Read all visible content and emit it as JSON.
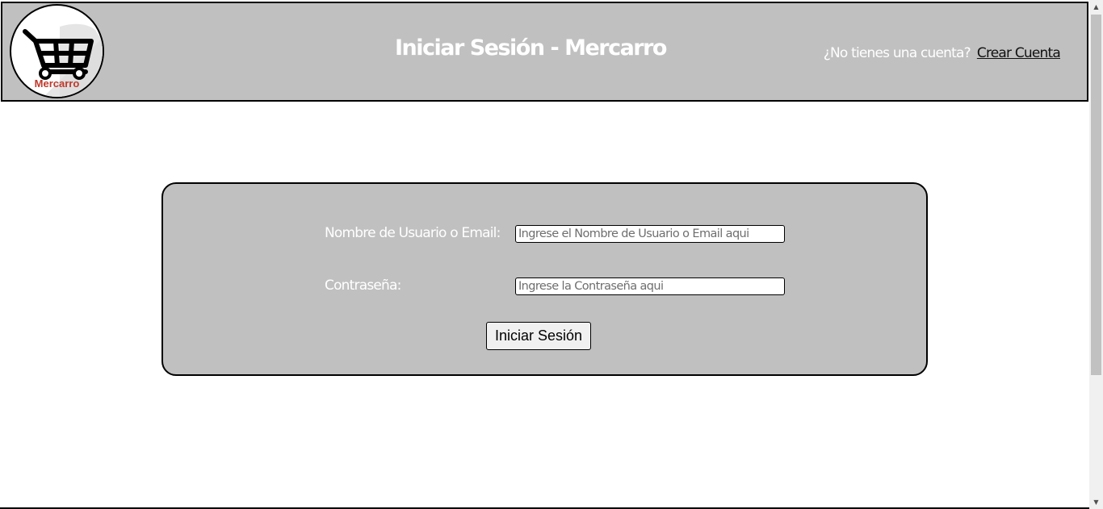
{
  "header": {
    "logo_text": "Mercarro",
    "title": "Iniciar Sesión - Mercarro",
    "account_prompt": "¿No tienes una cuenta?",
    "create_account_link": "Crear Cuenta"
  },
  "login_form": {
    "username": {
      "label": "Nombre de Usuario o Email:",
      "value": "",
      "placeholder": "Ingrese el Nombre de Usuario o Email aqui"
    },
    "password": {
      "label": "Contraseña:",
      "value": "",
      "placeholder": "Ingrese la Contraseña aqui"
    },
    "submit_label": "Iniciar Sesión"
  },
  "colors": {
    "header_bg": "#c0c0c0",
    "panel_bg": "#c0c0c0",
    "logo_text": "#c0392b",
    "heading_text": "#ffffff",
    "link_text": "#111111"
  },
  "icons": {
    "logo": "shopping-cart-icon",
    "scroll_up": "arrow-up-icon",
    "scroll_down": "arrow-down-icon"
  }
}
